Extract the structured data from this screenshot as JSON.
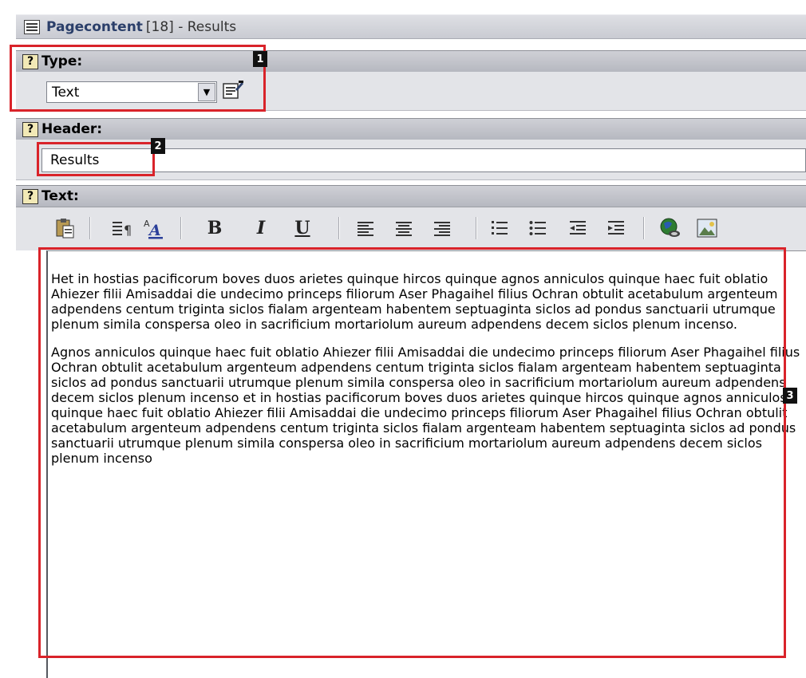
{
  "title": {
    "name": "Pagecontent",
    "rest": "[18] - Results"
  },
  "sections": {
    "type": {
      "label": "Type:",
      "value": "Text"
    },
    "header": {
      "label": "Header:",
      "value": "Results"
    },
    "text": {
      "label": "Text:"
    }
  },
  "help_glyph": "?",
  "toolbar": {
    "icons": [
      "paste-icon",
      "format-block-icon",
      "text-color-icon",
      "bold-icon",
      "italic-icon",
      "underline-icon",
      "align-left-icon",
      "align-center-icon",
      "align-right-icon",
      "ordered-list-icon",
      "unordered-list-icon",
      "outdent-icon",
      "indent-icon",
      "insert-link-icon",
      "insert-image-icon"
    ],
    "bold": "B",
    "italic": "I",
    "underline": "U",
    "fontcolor": "A"
  },
  "editor": {
    "paragraphs": [
      "Het in hostias pacificorum boves duos arietes quinque hircos quinque agnos anniculos quinque haec fuit oblatio Ahiezer filii Amisaddai die undecimo princeps filiorum Aser Phagaihel filius Ochran obtulit acetabulum argenteum adpendens centum triginta siclos fialam argenteam habentem septuaginta siclos ad pondus sanctuarii utrumque plenum simila conspersa oleo in sacrificium mortariolum aureum adpendens decem siclos plenum incenso.",
      "Agnos anniculos quinque haec fuit oblatio Ahiezer filii Amisaddai die undecimo princeps filiorum Aser Phagaihel filius Ochran obtulit acetabulum argenteum adpendens centum triginta siclos fialam argenteam habentem septuaginta siclos ad pondus sanctuarii utrumque plenum simila conspersa oleo in sacrificium mortariolum aureum adpendens decem siclos plenum incenso et in hostias pacificorum boves duos arietes quinque hircos quinque agnos anniculos quinque haec fuit oblatio Ahiezer filii Amisaddai die undecimo princeps filiorum Aser Phagaihel filius Ochran obtulit acetabulum argenteum adpendens centum triginta siclos fialam argenteam habentem septuaginta siclos ad pondus sanctuarii utrumque plenum simila conspersa oleo in sacrificium mortariolum aureum adpendens decem siclos plenum incenso"
    ]
  },
  "annotations": {
    "one": "1",
    "two": "2",
    "three": "3"
  },
  "colors": {
    "annotation": "#d9232a",
    "titleText": "#2b3f6a"
  }
}
